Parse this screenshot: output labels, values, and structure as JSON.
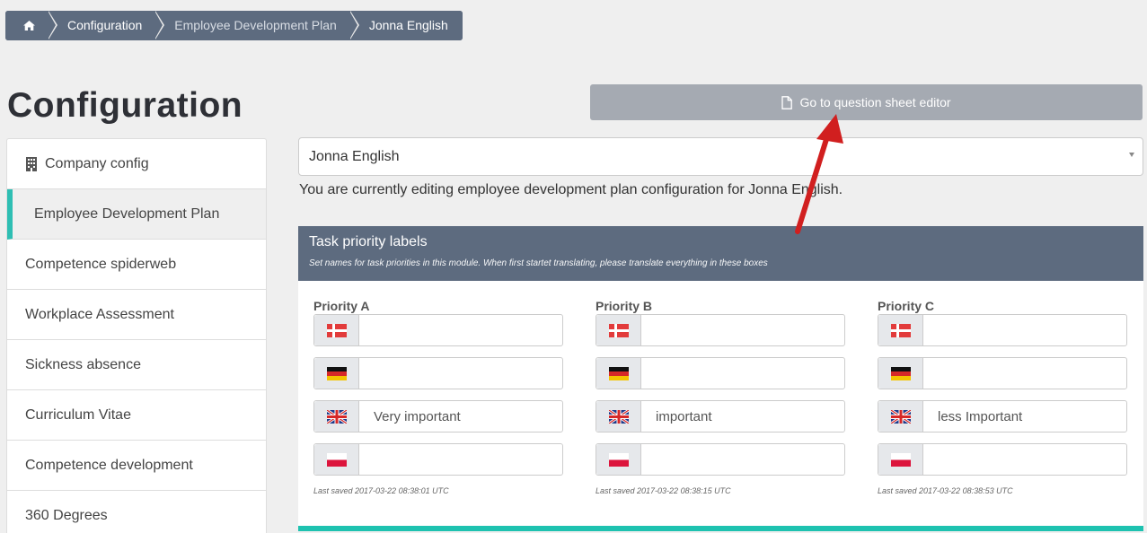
{
  "breadcrumb": {
    "items": [
      "Configuration",
      "Employee Development Plan",
      "Jonna English"
    ]
  },
  "page_title": "Configuration",
  "sidebar": {
    "items": [
      {
        "label": "Company config",
        "icon": "building-icon"
      },
      {
        "label": "Employee Development Plan",
        "active": true
      },
      {
        "label": "Competence spiderweb"
      },
      {
        "label": "Workplace Assessment"
      },
      {
        "label": "Sickness absence"
      },
      {
        "label": "Curriculum Vitae"
      },
      {
        "label": "Competence development"
      },
      {
        "label": "360 Degrees"
      }
    ]
  },
  "question_button": {
    "label": "Go to question sheet editor",
    "icon": "document-icon"
  },
  "employee_select": {
    "value": "Jonna English"
  },
  "info_text": "You are currently editing employee development plan configuration for Jonna English.",
  "panel": {
    "title": "Task priority labels",
    "subtitle": "Set names for task priorities in this module. When first startet translating, please translate everything in these boxes",
    "columns": [
      {
        "label": "Priority A",
        "values": {
          "da": "",
          "de": "",
          "en": "Very important",
          "pl": ""
        },
        "saved": "Last saved 2017-03-22 08:38:01 UTC"
      },
      {
        "label": "Priority B",
        "values": {
          "da": "",
          "de": "",
          "en": "important",
          "pl": ""
        },
        "saved": "Last saved 2017-03-22 08:38:15 UTC"
      },
      {
        "label": "Priority C",
        "values": {
          "da": "",
          "de": "",
          "en": "less Important",
          "pl": ""
        },
        "saved": "Last saved 2017-03-22 08:38:53 UTC"
      }
    ]
  },
  "colors": {
    "header_bg": "#5d6b7f",
    "accent": "#1ec2b0",
    "button_bg": "#a5aab2",
    "annotation_arrow": "#d11f1f"
  }
}
